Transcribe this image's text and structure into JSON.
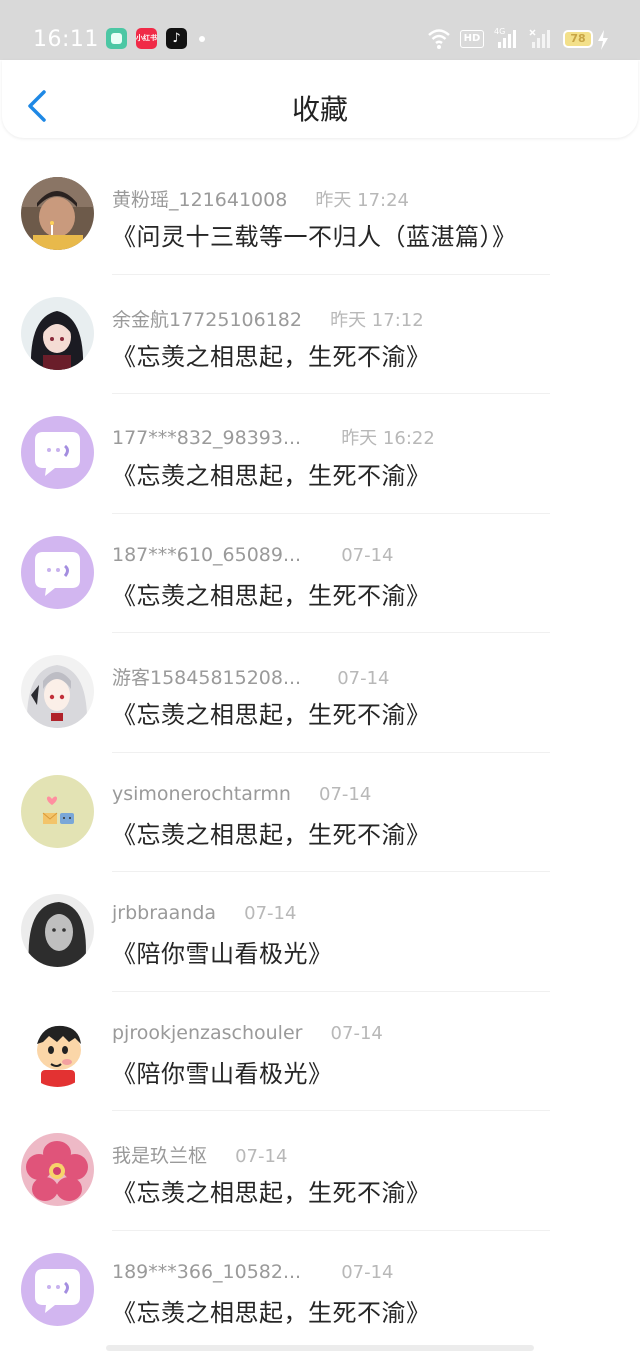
{
  "status": {
    "time": "16:11",
    "battery": "78",
    "badge_app2": "小红书",
    "badge_hd": "HD"
  },
  "nav": {
    "title": "收藏"
  },
  "items": [
    {
      "user": "黄粉瑶_121641008",
      "time": "昨天 17:24",
      "title": "《问灵十三载等一不归人（蓝湛篇）》",
      "avatar": "photo-child-candle"
    },
    {
      "user": "余金航17725106182",
      "time": "昨天 17:12",
      "title": "《忘羡之相思起，生死不渝》",
      "avatar": "anime-girl"
    },
    {
      "user": "177***832_98393...",
      "time": "昨天 16:22",
      "title": "《忘羡之相思起，生死不渝》",
      "avatar": "default-chat-bubble"
    },
    {
      "user": "187***610_65089...",
      "time": "07-14",
      "title": "《忘羡之相思起，生死不渝》",
      "avatar": "default-chat-bubble"
    },
    {
      "user": "游客15845815208...",
      "time": "07-14",
      "title": "《忘羡之相思起，生死不渝》",
      "avatar": "anime-white-hair"
    },
    {
      "user": "ysimonerochtarmn",
      "time": "07-14",
      "title": "《忘羡之相思起，生死不渝》",
      "avatar": "cute-mail"
    },
    {
      "user": "jrbbraanda",
      "time": "07-14",
      "title": "《陪你雪山看极光》",
      "avatar": "photo-woman-bw"
    },
    {
      "user": "pjrookjenzaschouler",
      "time": "07-14",
      "title": "《陪你雪山看极光》",
      "avatar": "cartoon-boy"
    },
    {
      "user": "我是玖兰枢",
      "time": "07-14",
      "title": "《忘羡之相思起，生死不渝》",
      "avatar": "pink-flower"
    },
    {
      "user": "189***366_10582...",
      "time": "07-14",
      "title": "《忘羡之相思起，生死不渝》",
      "avatar": "default-chat-bubble"
    }
  ],
  "colors": {
    "accent": "#1e88e5",
    "avatar_default": "#d2b6f0",
    "statusbar": "#d9d9d9"
  }
}
